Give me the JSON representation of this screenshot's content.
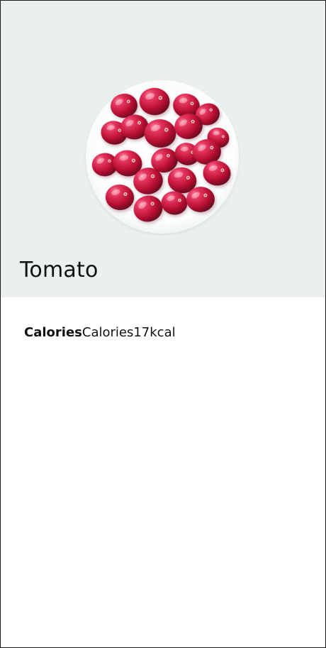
{
  "page": {
    "title": "Tomato",
    "hero_image_icon": "bowl-of-red-berries-image"
  },
  "nutrition": {
    "label": "Calories",
    "value": "Calories17kcal"
  },
  "colors": {
    "hero_background": "#e9f0ef",
    "page_background": "#ffffff",
    "text": "#111111",
    "fruit": "#c7173d"
  }
}
